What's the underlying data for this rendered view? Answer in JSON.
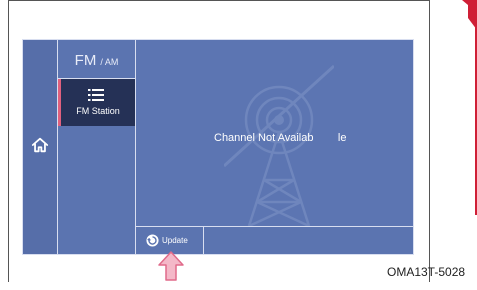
{
  "header": {
    "source_big": "FM",
    "source_small": "/ AM"
  },
  "sidebar": {
    "station_label": "FM Station"
  },
  "main": {
    "channel_message": "Channel Not Availab        le"
  },
  "bottom_bar": {
    "update_label": "Update"
  },
  "figure": {
    "caption": "OMA13T-5028"
  },
  "icons": {
    "home": "home-icon",
    "station_list": "list-icon",
    "update": "refresh-icon",
    "tower": "radio-tower-icon",
    "pointer": "arrow-up-icon",
    "return": "return-icon"
  },
  "colors": {
    "screen_bg": "#5b74b0",
    "station_active_bg": "#253156",
    "station_active_accent": "#e0607e",
    "side_tab": "#cf1f36"
  }
}
